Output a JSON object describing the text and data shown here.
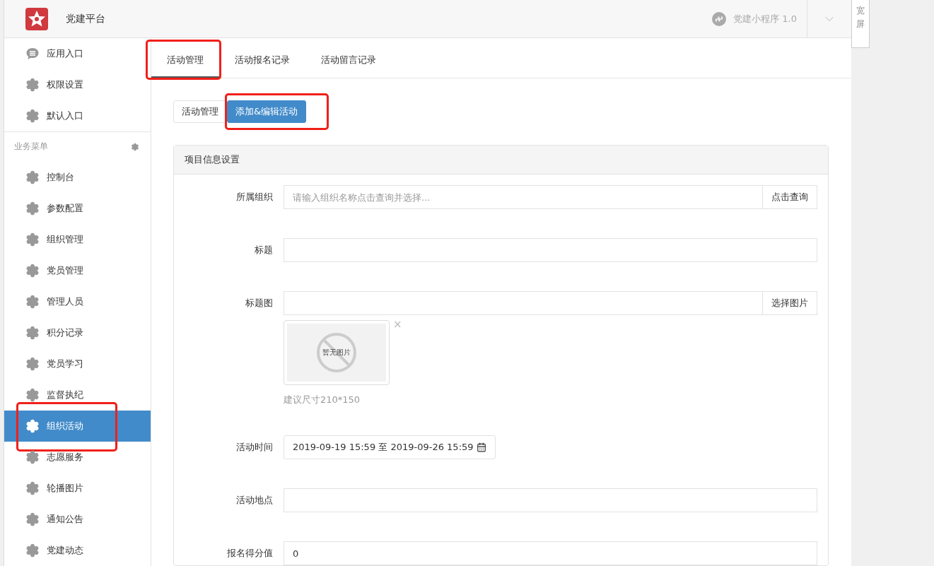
{
  "header": {
    "title": "党建平台",
    "app_name": "党建小程序 1.0"
  },
  "wide_screen_tab": "宽屏",
  "sidebar": {
    "top_items": [
      {
        "label": "应用入口",
        "kind": "chat",
        "selected": false,
        "highlighted": false
      },
      {
        "label": "权限设置",
        "kind": "gear",
        "selected": false,
        "highlighted": false
      },
      {
        "label": "默认入口",
        "kind": "gear",
        "selected": false,
        "highlighted": false
      }
    ],
    "section_title": "业务菜单",
    "items": [
      {
        "label": "控制台",
        "selected": false,
        "highlighted": false
      },
      {
        "label": "参数配置",
        "selected": false,
        "highlighted": false
      },
      {
        "label": "组织管理",
        "selected": false,
        "highlighted": false
      },
      {
        "label": "党员管理",
        "selected": false,
        "highlighted": false
      },
      {
        "label": "管理人员",
        "selected": false,
        "highlighted": false
      },
      {
        "label": "积分记录",
        "selected": false,
        "highlighted": false
      },
      {
        "label": "党员学习",
        "selected": false,
        "highlighted": false
      },
      {
        "label": "监督执纪",
        "selected": false,
        "highlighted": false
      },
      {
        "label": "组织活动",
        "selected": true,
        "highlighted": true
      },
      {
        "label": "志愿服务",
        "selected": false,
        "highlighted": false
      },
      {
        "label": "轮播图片",
        "selected": false,
        "highlighted": false
      },
      {
        "label": "通知公告",
        "selected": false,
        "highlighted": false
      },
      {
        "label": "党建动态",
        "selected": false,
        "highlighted": false
      }
    ]
  },
  "tabs": [
    {
      "label": "活动管理",
      "selected": true,
      "highlighted": true
    },
    {
      "label": "活动报名记录",
      "selected": false,
      "highlighted": false
    },
    {
      "label": "活动留言记录",
      "selected": false,
      "highlighted": false
    }
  ],
  "sub_buttons": [
    {
      "label": "活动管理",
      "selected": false,
      "highlighted": false
    },
    {
      "label": "添加&编辑活动",
      "selected": true,
      "highlighted": true
    }
  ],
  "panel": {
    "title": "项目信息设置",
    "fields": [
      {
        "kind": "search",
        "label": "所属组织",
        "placeholder": "请输入组织名称点击查询并选择...",
        "button": "点击查询"
      },
      {
        "kind": "text",
        "label": "标题"
      },
      {
        "kind": "image",
        "label": "标题图",
        "button": "选择图片",
        "image_text": "暂无图片",
        "close": "×",
        "hint": "建议尺寸210*150"
      },
      {
        "kind": "daterange",
        "label": "活动时间",
        "value": "2019-09-19 15:59 至 2019-09-26 15:59"
      },
      {
        "kind": "text",
        "label": "活动地点"
      },
      {
        "kind": "text",
        "label": "报名得分值",
        "value": "0"
      }
    ]
  }
}
